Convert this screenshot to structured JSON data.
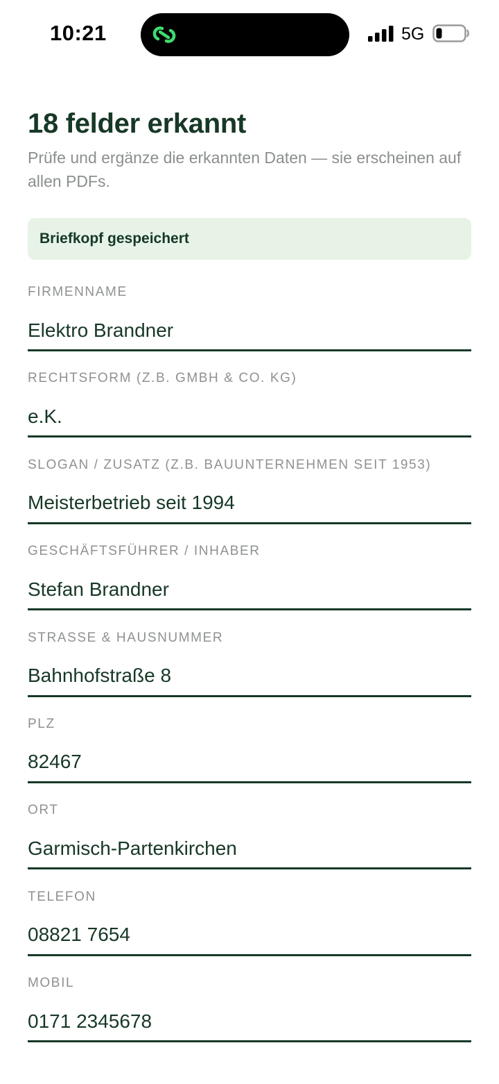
{
  "status_bar": {
    "time": "10:21",
    "network": "5G"
  },
  "header": {
    "title": "18 felder erkannt",
    "subtitle": "Prüfe und ergänze die erkannten Daten — sie erscheinen auf allen PDFs."
  },
  "banner": {
    "text": "Briefkopf gespeichert"
  },
  "colors": {
    "accent": "#173826",
    "banner_bg": "#e6f3e6",
    "label": "#8e928f",
    "island_icon": "#3ddc6e"
  },
  "fields": [
    {
      "label": "FIRMENNAME",
      "value": "Elektro Brandner"
    },
    {
      "label": "RECHTSFORM (Z.B. GMBH & CO. KG)",
      "value": "e.K."
    },
    {
      "label": "SLOGAN / ZUSATZ (Z.B. BAUUNTERNEHMEN SEIT 1953)",
      "value": "Meisterbetrieb seit 1994"
    },
    {
      "label": "GESCHÄFTSFÜHRER / INHABER",
      "value": "Stefan Brandner"
    },
    {
      "label": "STRASSE & HAUSNUMMER",
      "value": "Bahnhofstraße 8"
    },
    {
      "label": "PLZ",
      "value": "82467"
    },
    {
      "label": "ORT",
      "value": "Garmisch-Partenkirchen"
    },
    {
      "label": "TELEFON",
      "value": "08821 7654"
    },
    {
      "label": "MOBIL",
      "value": "0171 2345678"
    }
  ]
}
